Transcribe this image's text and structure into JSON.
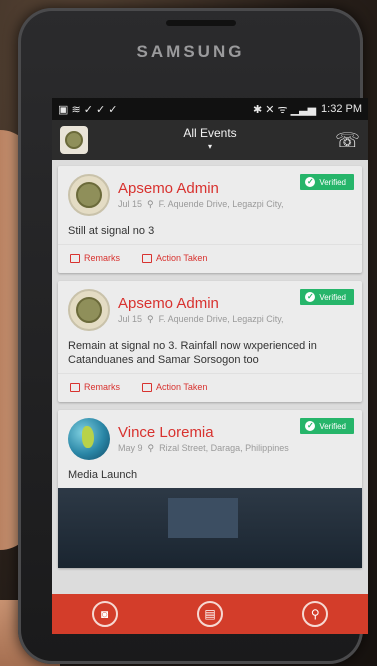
{
  "device": {
    "brand": "SAMSUNG"
  },
  "statusbar": {
    "time": "1:32 PM",
    "left_icons": "▣ ≋ ✓ ✓ ✓",
    "right_icons": "✱ ✕ ᯤ ▁▃▅"
  },
  "appbar": {
    "title": "All Events",
    "caret": "▾",
    "phone_glyph": "☏"
  },
  "posts": [
    {
      "author": "Apsemo Admin",
      "date": "Jul 15",
      "location": "F. Aquende Drive, Legazpi City,",
      "verified_label": "Verified",
      "message": "Still at signal no 3",
      "remarks_label": "Remarks",
      "action_label": "Action Taken"
    },
    {
      "author": "Apsemo Admin",
      "date": "Jul 15",
      "location": "F. Aquende Drive, Legazpi City,",
      "verified_label": "Verified",
      "message": "Remain at signal no 3. Rainfall now wxperienced in Catanduanes and Samar Sorsogon too",
      "remarks_label": "Remarks",
      "action_label": "Action Taken"
    },
    {
      "author": "Vince Loremia",
      "date": "May 9",
      "location": "Rizal Street, Daraga, Philippines",
      "verified_label": "Verified",
      "message": "Media Launch"
    }
  ],
  "icons": {
    "location": "location-pin-icon",
    "verified": "check-circle-icon",
    "remarks": "comment-icon",
    "action": "checkbox-icon",
    "nav": [
      "camera-icon",
      "document-icon",
      "map-pin-icon"
    ]
  },
  "colors": {
    "accent": "#d8322f",
    "verified": "#26b56a",
    "bottom_bar": "#d33d2a"
  }
}
